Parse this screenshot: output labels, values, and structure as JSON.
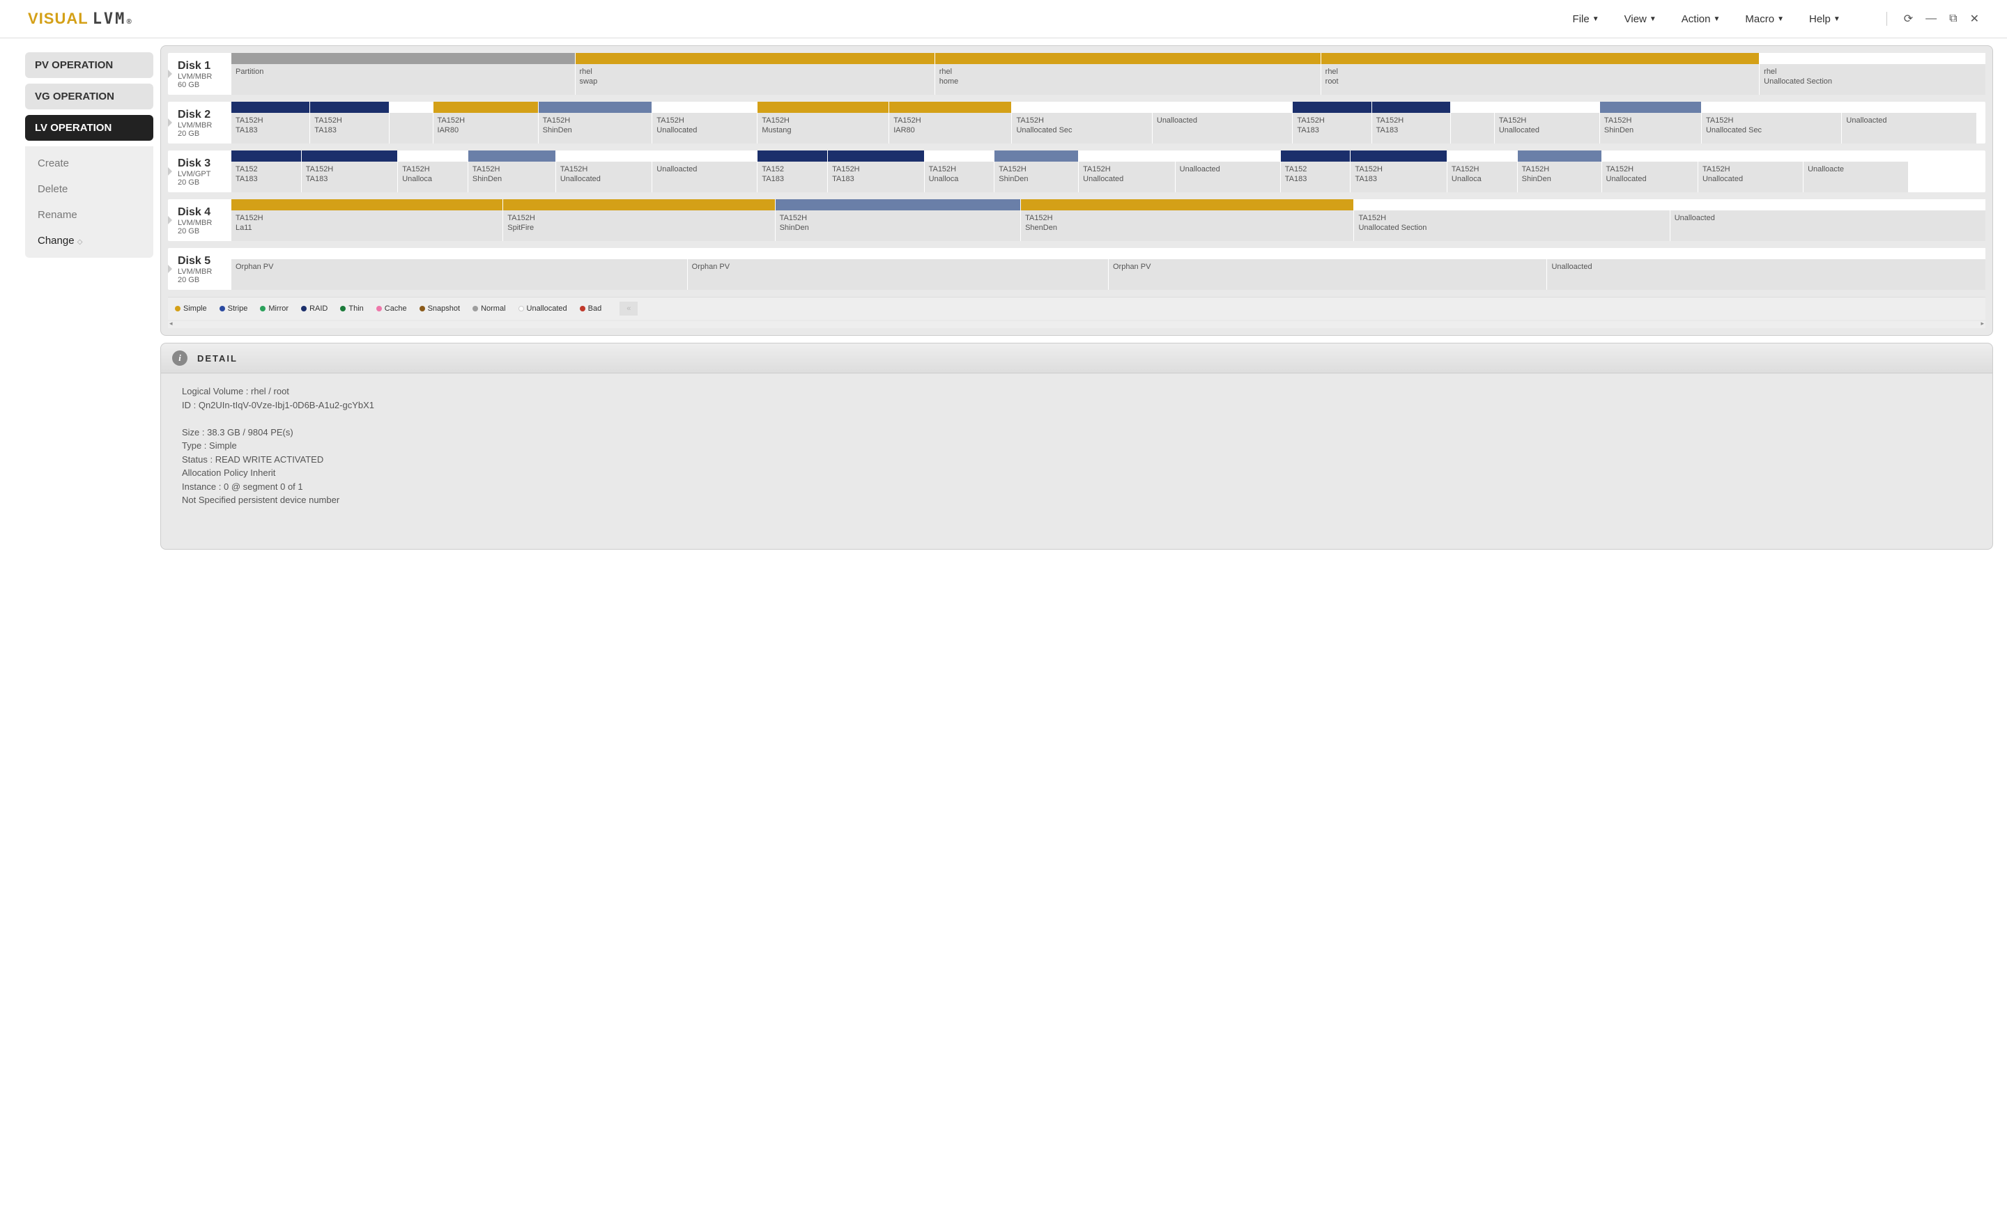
{
  "app": {
    "logo_part1": "V",
    "logo_part2": "ISUAL",
    "logo_part3": "LVM",
    "logo_reg": "®"
  },
  "menu": {
    "file": "File",
    "view": "View",
    "action": "Action",
    "macro": "Macro",
    "help": "Help"
  },
  "sidebar": {
    "pv": "PV OPERATION",
    "vg": "VG OPERATION",
    "lv": "LV OPERATION",
    "items": [
      "Create",
      "Delete",
      "Rename",
      "Change"
    ]
  },
  "legend": {
    "simple": "Simple",
    "stripe": "Stripe",
    "mirror": "Mirror",
    "raid": "RAID",
    "thin": "Thin",
    "cache": "Cache",
    "snapshot": "Snapshot",
    "normal": "Normal",
    "unallocated": "Unallocated",
    "bad": "Bad"
  },
  "colors": {
    "simple": "#d4a017",
    "stripe": "#2b4aa0",
    "mirror": "#2aa05a",
    "raid": "#1b2f6b",
    "thin": "#1b7a3a",
    "cache": "#e7a",
    "snapshot": "#8a5a1a",
    "normal": "#9e9e9e",
    "unallocated": "#ffffff",
    "bad": "#c0392b"
  },
  "disks": [
    {
      "name": "Disk 1",
      "scheme": "LVM/MBR",
      "size": "60 GB",
      "segs": [
        {
          "w": 19.6,
          "color": "c-gray",
          "t1": "Partition",
          "t2": ""
        },
        {
          "w": 20.5,
          "color": "c-yellow",
          "t1": "rhel",
          "t2": "swap"
        },
        {
          "w": 22.0,
          "color": "c-yellow",
          "t1": "rhel",
          "t2": "home"
        },
        {
          "w": 25.0,
          "color": "c-yellow",
          "t1": "rhel",
          "t2": "root"
        },
        {
          "w": 12.9,
          "color": "c-white",
          "t1": "rhel",
          "t2": "Unallocated Section"
        }
      ]
    },
    {
      "name": "Disk 2",
      "scheme": "LVM/MBR",
      "size": "20 GB",
      "segs": [
        {
          "w": 4.5,
          "color": "c-navy",
          "t1": "TA152H",
          "t2": "TA183"
        },
        {
          "w": 4.5,
          "color": "c-navy",
          "t1": "TA152H",
          "t2": "TA183"
        },
        {
          "w": 2.5,
          "color": "c-white",
          "t1": "",
          "t2": ""
        },
        {
          "w": 6.0,
          "color": "c-yellow",
          "t1": "TA152H",
          "t2": "IAR80"
        },
        {
          "w": 6.5,
          "color": "c-steel",
          "t1": "TA152H",
          "t2": "ShinDen"
        },
        {
          "w": 6.0,
          "color": "c-white",
          "t1": "TA152H",
          "t2": "Unallocated"
        },
        {
          "w": 7.5,
          "color": "c-yellow",
          "t1": "TA152H",
          "t2": "Mustang"
        },
        {
          "w": 7.0,
          "color": "c-yellow",
          "t1": "TA152H",
          "t2": "IAR80"
        },
        {
          "w": 8.0,
          "color": "c-white",
          "t1": "TA152H",
          "t2": "Unallocated Sec"
        },
        {
          "w": 8.0,
          "color": "c-white",
          "t1": "Unalloacted",
          "t2": ""
        },
        {
          "w": 4.5,
          "color": "c-navy",
          "t1": "TA152H",
          "t2": "TA183"
        },
        {
          "w": 4.5,
          "color": "c-navy",
          "t1": "TA152H",
          "t2": "TA183"
        },
        {
          "w": 2.5,
          "color": "c-white",
          "t1": "",
          "t2": ""
        },
        {
          "w": 6.0,
          "color": "c-white",
          "t1": "TA152H",
          "t2": "Unallocated"
        },
        {
          "w": 5.8,
          "color": "c-steel",
          "t1": "TA152H",
          "t2": "ShinDen"
        },
        {
          "w": 8.0,
          "color": "c-white",
          "t1": "TA152H",
          "t2": "Unallocated Sec"
        },
        {
          "w": 7.7,
          "color": "c-white",
          "t1": "Unalloacted",
          "t2": ""
        }
      ]
    },
    {
      "name": "Disk 3",
      "scheme": "LVM/GPT",
      "size": "20 GB",
      "segs": [
        {
          "w": 4.0,
          "color": "c-navy",
          "t1": "TA152",
          "t2": "TA183"
        },
        {
          "w": 5.5,
          "color": "c-navy",
          "t1": "TA152H",
          "t2": "TA183"
        },
        {
          "w": 4.0,
          "color": "c-white",
          "t1": "TA152H",
          "t2": "Unalloca"
        },
        {
          "w": 5.0,
          "color": "c-steel",
          "t1": "TA152H",
          "t2": "ShinDen"
        },
        {
          "w": 5.5,
          "color": "c-white",
          "t1": "TA152H",
          "t2": "Unallocated"
        },
        {
          "w": 6.0,
          "color": "c-white",
          "t1": "Unalloacted",
          "t2": ""
        },
        {
          "w": 4.0,
          "color": "c-navy",
          "t1": "TA152",
          "t2": "TA183"
        },
        {
          "w": 5.5,
          "color": "c-navy",
          "t1": "TA152H",
          "t2": "TA183"
        },
        {
          "w": 4.0,
          "color": "c-white",
          "t1": "TA152H",
          "t2": "Unalloca"
        },
        {
          "w": 4.8,
          "color": "c-steel",
          "t1": "TA152H",
          "t2": "ShinDen"
        },
        {
          "w": 5.5,
          "color": "c-white",
          "t1": "TA152H",
          "t2": "Unallocated"
        },
        {
          "w": 6.0,
          "color": "c-white",
          "t1": "Unalloacted",
          "t2": ""
        },
        {
          "w": 4.0,
          "color": "c-navy",
          "t1": "TA152",
          "t2": "TA183"
        },
        {
          "w": 5.5,
          "color": "c-navy",
          "t1": "TA152H",
          "t2": "TA183"
        },
        {
          "w": 4.0,
          "color": "c-white",
          "t1": "TA152H",
          "t2": "Unalloca"
        },
        {
          "w": 4.8,
          "color": "c-steel",
          "t1": "TA152H",
          "t2": "ShinDen"
        },
        {
          "w": 5.5,
          "color": "c-white",
          "t1": "TA152H",
          "t2": "Unallocated"
        },
        {
          "w": 6.0,
          "color": "c-white",
          "t1": "TA152H",
          "t2": "Unallocated"
        },
        {
          "w": 6.0,
          "color": "c-white",
          "t1": "Unalloacte",
          "t2": ""
        }
      ]
    },
    {
      "name": "Disk 4",
      "scheme": "LVM/MBR",
      "size": "20 GB",
      "segs": [
        {
          "w": 15.5,
          "color": "c-yellow",
          "t1": "TA152H",
          "t2": "La11"
        },
        {
          "w": 15.5,
          "color": "c-yellow",
          "t1": "TA152H",
          "t2": "SpitFire"
        },
        {
          "w": 14.0,
          "color": "c-steel",
          "t1": "TA152H",
          "t2": "ShinDen"
        },
        {
          "w": 19.0,
          "color": "c-yellow",
          "t1": "TA152H",
          "t2": "ShenDen"
        },
        {
          "w": 18.0,
          "color": "c-white",
          "t1": "TA152H",
          "t2": "Unallocated Section"
        },
        {
          "w": 18.0,
          "color": "c-white",
          "t1": "Unalloacted",
          "t2": ""
        }
      ]
    },
    {
      "name": "Disk 5",
      "scheme": "LVM/MBR",
      "size": "20 GB",
      "segs": [
        {
          "w": 26.0,
          "color": "c-white",
          "t1": "Orphan PV",
          "t2": ""
        },
        {
          "w": 24.0,
          "color": "c-white",
          "t1": "Orphan PV",
          "t2": ""
        },
        {
          "w": 25.0,
          "color": "c-white",
          "t1": "Orphan PV",
          "t2": ""
        },
        {
          "w": 25.0,
          "color": "c-white",
          "t1": "Unalloacted",
          "t2": ""
        }
      ]
    }
  ],
  "detail": {
    "title": "DETAIL",
    "lines": [
      "Logical Volume : rhel / root",
      "ID : Qn2UIn-tIqV-0Vze-Ibj1-0D6B-A1u2-gcYbX1",
      "",
      "Size : 38.3 GB / 9804 PE(s)",
      "Type : Simple",
      "Status : READ WRITE ACTIVATED",
      "Allocation Policy Inherit",
      "Instance : 0 @ segment 0 of 1",
      "Not Specified persistent device number"
    ]
  }
}
